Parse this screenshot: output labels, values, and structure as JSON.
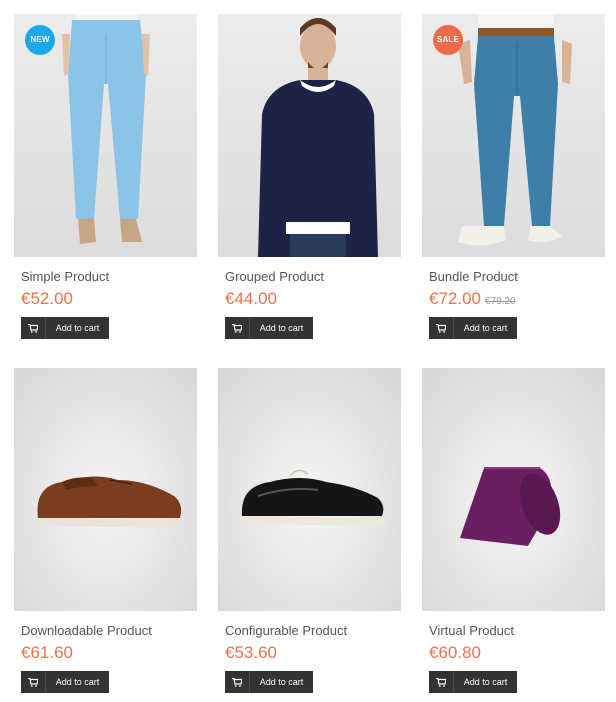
{
  "products": [
    {
      "name": "Simple Product",
      "price": "€52.00",
      "old_price": "",
      "badge": "NEW",
      "badge_color": "#1ca7e8",
      "cart_label": "Add to cart",
      "image": "light-blue-chinos"
    },
    {
      "name": "Grouped Product",
      "price": "€44.00",
      "old_price": "",
      "badge": "",
      "badge_color": "",
      "cart_label": "Add to cart",
      "image": "navy-sweater"
    },
    {
      "name": "Bundle Product",
      "price": "€72.00",
      "old_price": "€79.20",
      "badge": "SALE",
      "badge_color": "#ee6b4a",
      "cart_label": "Add to cart",
      "image": "blue-skinny-jeans"
    },
    {
      "name": "Downloadable Product",
      "price": "€61.60",
      "old_price": "",
      "badge": "",
      "badge_color": "",
      "cart_label": "Add to cart",
      "image": "brown-suede-brogue"
    },
    {
      "name": "Configurable Product",
      "price": "€53.60",
      "old_price": "",
      "badge": "",
      "badge_color": "",
      "cart_label": "Add to cart",
      "image": "black-leather-shoe"
    },
    {
      "name": "Virtual Product",
      "price": "€60.80",
      "old_price": "",
      "badge": "",
      "badge_color": "",
      "cart_label": "Add to cart",
      "image": "purple-tie"
    }
  ],
  "icons": {
    "cart": "cart-icon"
  },
  "colors": {
    "price": "#e9734a",
    "button": "#333333"
  }
}
